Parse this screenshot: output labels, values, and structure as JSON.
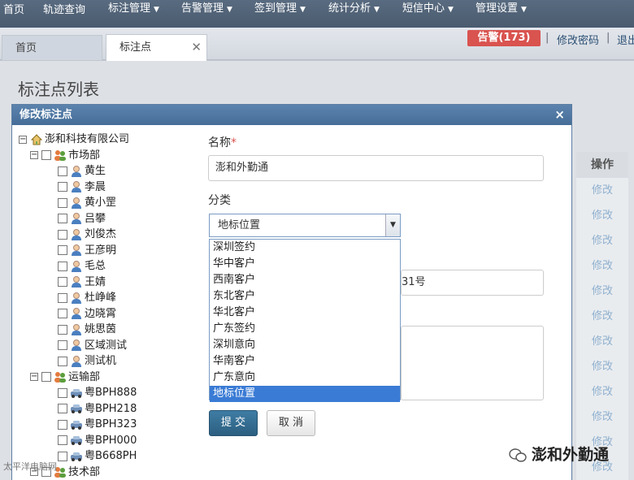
{
  "nav": {
    "items": [
      "首页",
      "轨迹查询",
      "标注管理",
      "告警管理",
      "签到管理",
      "统计分析",
      "短信中心",
      "管理设置"
    ],
    "has_dropdown": [
      false,
      false,
      true,
      true,
      true,
      true,
      true,
      true
    ]
  },
  "tabs": [
    {
      "label": "首页"
    },
    {
      "label": "标注点"
    }
  ],
  "alarm": "告警(173)",
  "links": {
    "change_password": "修改密码",
    "sep": "|",
    "logout": "退出"
  },
  "page_title": "标注点列表",
  "table": {
    "op_header": "操作",
    "op_label": "修改"
  },
  "dialog": {
    "title": "修改标注点",
    "close": "×"
  },
  "tree": {
    "root": "澎和科技有限公司",
    "groups": [
      {
        "name": "市场部",
        "items": [
          "黄生",
          "李晨",
          "黄小罡",
          "吕攀",
          "刘俊杰",
          "王彦明",
          "毛总",
          "王婧",
          "杜峥峰",
          "边晓霄",
          "姚思茵",
          "区域测试",
          "测试机"
        ]
      },
      {
        "name": "运输部",
        "items": [
          "粤BPH888",
          "粤BPH218",
          "粤BPH323",
          "粤BPH000",
          "粤B668PH"
        ]
      },
      {
        "name": "技术部",
        "items": []
      }
    ]
  },
  "form": {
    "name_label": "名称",
    "required_mark": "*",
    "name_value": "澎和外勤通",
    "category_label": "分类",
    "category_value": "地标位置",
    "address_value_partial": "31号",
    "options": [
      "深圳签约",
      "华中客户",
      "西南客户",
      "东北客户",
      "华北客户",
      "广东签约",
      "深圳意向",
      "华南客户",
      "广东意向",
      "地标位置"
    ],
    "selected_index": 9,
    "submit_label": "提 交",
    "cancel_label": "取 消"
  },
  "watermark": "澎和外勤通",
  "watermark_left": "太平洋电脑网",
  "colors": {
    "nav": "#4f6277",
    "alarm": "#d9534f",
    "dialog_head": "#4f77a1",
    "select_highlight": "#3a7bd5",
    "submit": "#336a8e"
  }
}
